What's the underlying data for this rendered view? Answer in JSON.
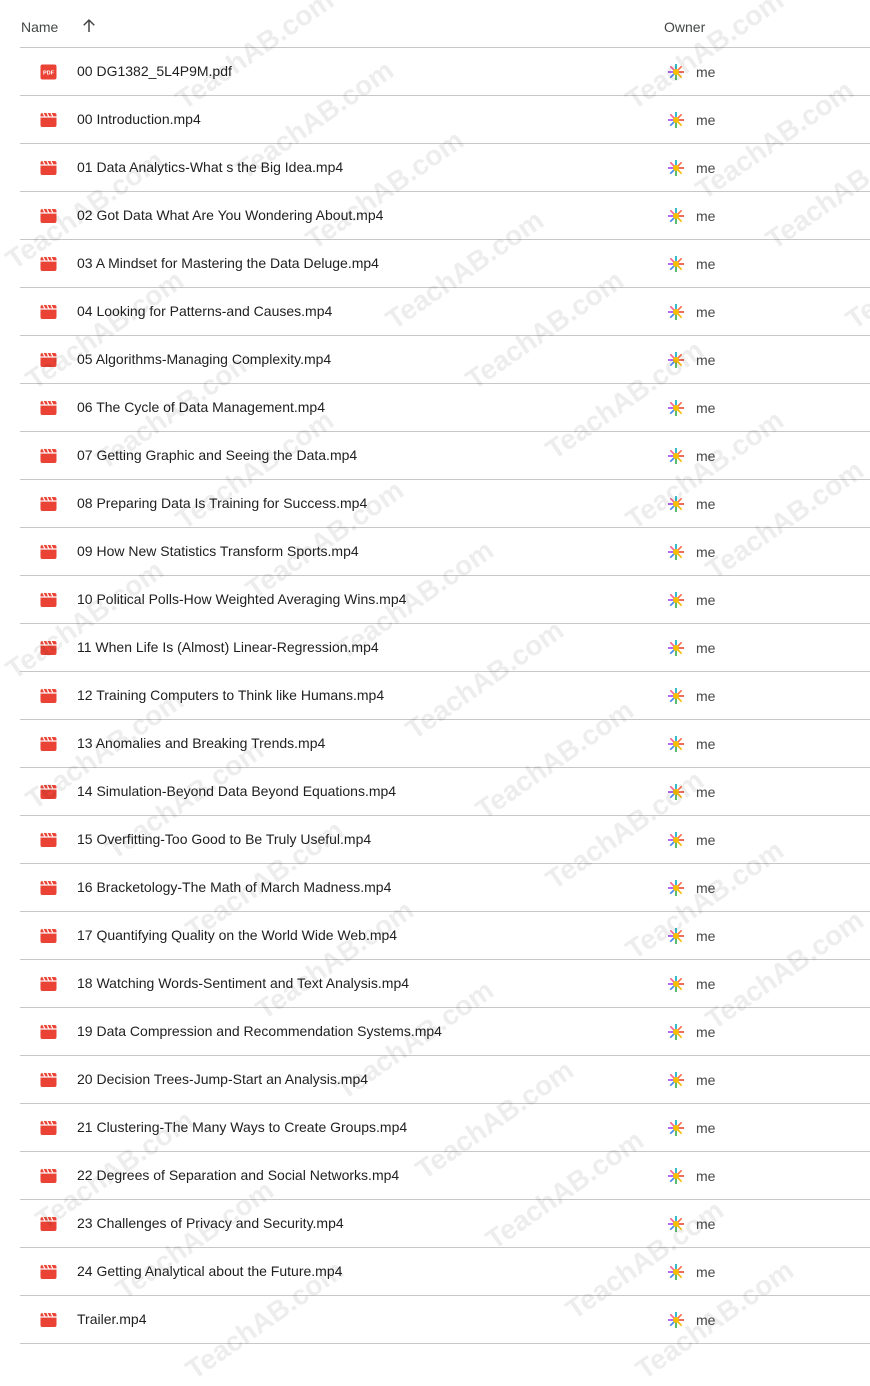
{
  "header": {
    "name_label": "Name",
    "owner_label": "Owner",
    "sort_icon": "arrow-upward-icon"
  },
  "watermark": "TeachAB.com",
  "files": [
    {
      "name": "00 DG1382_5L4P9M.pdf",
      "type": "pdf",
      "owner": "me"
    },
    {
      "name": "00 Introduction.mp4",
      "type": "video",
      "owner": "me"
    },
    {
      "name": "01 Data Analytics-What s the Big Idea.mp4",
      "type": "video",
      "owner": "me"
    },
    {
      "name": "02 Got Data What Are You Wondering About.mp4",
      "type": "video",
      "owner": "me"
    },
    {
      "name": "03 A Mindset for Mastering the Data Deluge.mp4",
      "type": "video",
      "owner": "me"
    },
    {
      "name": "04 Looking for Patterns-and Causes.mp4",
      "type": "video",
      "owner": "me"
    },
    {
      "name": "05 Algorithms-Managing Complexity.mp4",
      "type": "video",
      "owner": "me"
    },
    {
      "name": "06 The Cycle of Data Management.mp4",
      "type": "video",
      "owner": "me"
    },
    {
      "name": "07 Getting Graphic and Seeing the Data.mp4",
      "type": "video",
      "owner": "me"
    },
    {
      "name": "08 Preparing Data Is Training for Success.mp4",
      "type": "video",
      "owner": "me"
    },
    {
      "name": "09 How New Statistics Transform Sports.mp4",
      "type": "video",
      "owner": "me"
    },
    {
      "name": "10 Political Polls-How Weighted Averaging Wins.mp4",
      "type": "video",
      "owner": "me"
    },
    {
      "name": "11 When Life Is (Almost) Linear-Regression.mp4",
      "type": "video",
      "owner": "me"
    },
    {
      "name": "12 Training Computers to Think like Humans.mp4",
      "type": "video",
      "owner": "me"
    },
    {
      "name": "13 Anomalies and Breaking Trends.mp4",
      "type": "video",
      "owner": "me"
    },
    {
      "name": "14 Simulation-Beyond Data Beyond Equations.mp4",
      "type": "video",
      "owner": "me"
    },
    {
      "name": "15 Overfitting-Too Good to Be Truly Useful.mp4",
      "type": "video",
      "owner": "me"
    },
    {
      "name": "16 Bracketology-The Math of March Madness.mp4",
      "type": "video",
      "owner": "me"
    },
    {
      "name": "17 Quantifying Quality on the World Wide Web.mp4",
      "type": "video",
      "owner": "me"
    },
    {
      "name": "18 Watching Words-Sentiment and Text Analysis.mp4",
      "type": "video",
      "owner": "me"
    },
    {
      "name": "19 Data Compression and Recommendation Systems.mp4",
      "type": "video",
      "owner": "me"
    },
    {
      "name": "20 Decision Trees-Jump-Start an Analysis.mp4",
      "type": "video",
      "owner": "me"
    },
    {
      "name": "21 Clustering-The Many Ways to Create Groups.mp4",
      "type": "video",
      "owner": "me"
    },
    {
      "name": "22 Degrees of Separation and Social Networks.mp4",
      "type": "video",
      "owner": "me"
    },
    {
      "name": "23 Challenges of Privacy and Security.mp4",
      "type": "video",
      "owner": "me"
    },
    {
      "name": "24 Getting Analytical about the Future.mp4",
      "type": "video",
      "owner": "me"
    },
    {
      "name": "Trailer.mp4",
      "type": "video",
      "owner": "me"
    }
  ],
  "colors": {
    "file_icon_red": "#ea4335",
    "text": "#1f1f1f",
    "muted": "#444746",
    "divider": "#c7c7c7"
  }
}
